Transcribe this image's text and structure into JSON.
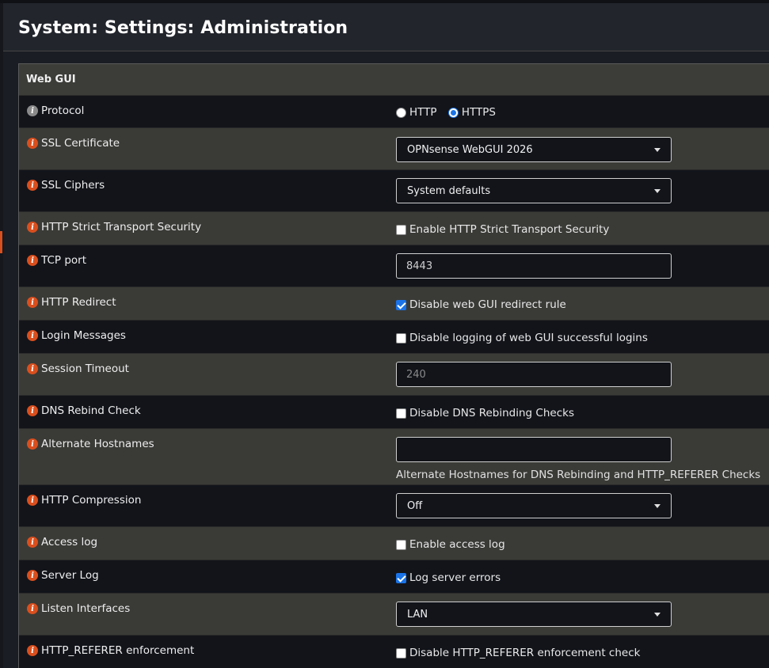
{
  "page": {
    "title": "System: Settings: Administration"
  },
  "panel": {
    "title": "Web GUI"
  },
  "rows": {
    "protocol": {
      "label": "Protocol",
      "opt_http": "HTTP",
      "opt_https": "HTTPS",
      "selected": "HTTPS"
    },
    "ssl_cert": {
      "label": "SSL Certificate",
      "value": "OPNsense WebGUI 2026"
    },
    "ssl_ciphers": {
      "label": "SSL Ciphers",
      "value": "System defaults"
    },
    "hsts": {
      "label": "HTTP Strict Transport Security",
      "option": "Enable HTTP Strict Transport Security",
      "checked": false
    },
    "tcp_port": {
      "label": "TCP port",
      "value": "8443"
    },
    "http_redirect": {
      "label": "HTTP Redirect",
      "option": "Disable web GUI redirect rule",
      "checked": true
    },
    "login_messages": {
      "label": "Login Messages",
      "option": "Disable logging of web GUI successful logins",
      "checked": false
    },
    "session_timeout": {
      "label": "Session Timeout",
      "placeholder": "240"
    },
    "dns_rebind": {
      "label": "DNS Rebind Check",
      "option": "Disable DNS Rebinding Checks",
      "checked": false
    },
    "alt_hostnames": {
      "label": "Alternate Hostnames",
      "value": "",
      "hint": "Alternate Hostnames for DNS Rebinding and HTTP_REFERER Checks"
    },
    "http_compression": {
      "label": "HTTP Compression",
      "value": "Off"
    },
    "access_log": {
      "label": "Access log",
      "option": "Enable access log",
      "checked": false
    },
    "server_log": {
      "label": "Server Log",
      "option": "Log server errors",
      "checked": true
    },
    "listen_interfaces": {
      "label": "Listen Interfaces",
      "value": "LAN"
    },
    "referer": {
      "label": "HTTP_REFERER enforcement",
      "option": "Disable HTTP_REFERER enforcement check",
      "checked": false
    }
  },
  "colors": {
    "accent": "#d94f1e",
    "info_grey": "#8a8a8a",
    "check_blue": "#1a73e8"
  }
}
